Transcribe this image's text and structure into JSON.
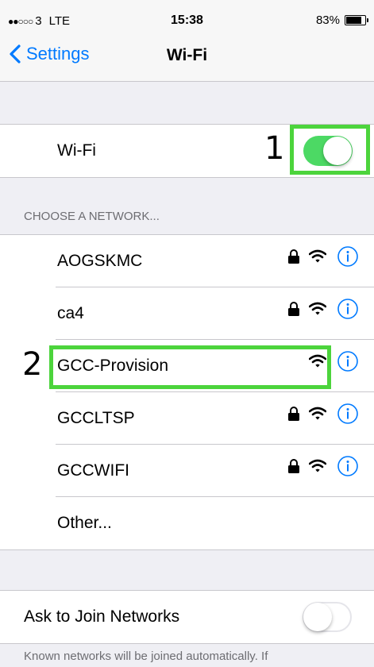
{
  "status_bar": {
    "signal_dots": "●●○○○",
    "carrier": "3",
    "network_type": "LTE",
    "time": "15:38",
    "battery_percent": "83%",
    "battery_level": 0.83
  },
  "nav": {
    "back_label": "Settings",
    "title": "Wi-Fi"
  },
  "wifi_toggle": {
    "label": "Wi-Fi",
    "on": true
  },
  "section_header": "CHOOSE A NETWORK...",
  "networks": [
    {
      "name": "AOGSKMC",
      "secured": true
    },
    {
      "name": "ca4",
      "secured": true
    },
    {
      "name": "GCC-Provision",
      "secured": false
    },
    {
      "name": "GCCLTSP",
      "secured": true
    },
    {
      "name": "GCCWIFI",
      "secured": true
    }
  ],
  "other_label": "Other...",
  "ask_to_join": {
    "label": "Ask to Join Networks",
    "on": false
  },
  "footer_text": "Known networks will be joined automatically. If",
  "annotations": {
    "step1": "1",
    "step2": "2"
  },
  "colors": {
    "accent": "#007aff",
    "toggle_on": "#4cd964",
    "highlight": "#4cd43c"
  },
  "icons": [
    "chevron-left-icon",
    "lock-icon",
    "wifi-icon",
    "info-icon"
  ]
}
